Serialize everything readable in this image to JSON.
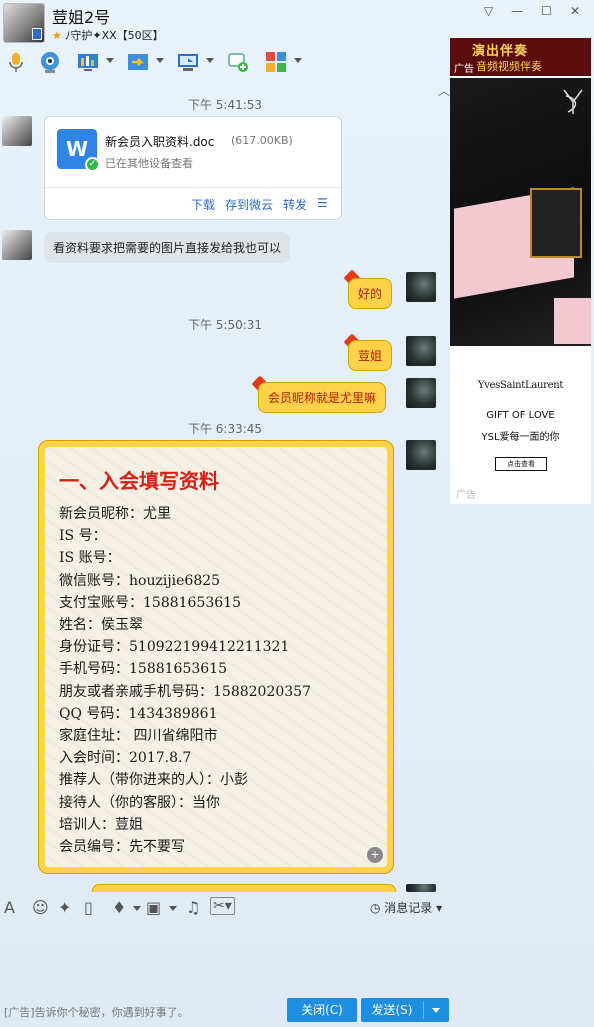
{
  "header": {
    "title": "荳姐2号",
    "status": "ﾉ守护✦XX【50区】",
    "window_controls": {
      "menu": "▽",
      "minimize": "—",
      "maximize": "☐",
      "close": "✕"
    }
  },
  "toolbar": {
    "icons": [
      "microphone-icon",
      "video-call-icon",
      "screen-share-icon",
      "file-transfer-icon",
      "remote-desktop-icon",
      "new-chat-icon",
      "apps-icon"
    ]
  },
  "messages": {
    "time1": "下午 5:41:53",
    "file": {
      "name": "新会员入职资料.doc",
      "size": "(617.00KB)",
      "sub": "已在其他设备查看",
      "download": "下载",
      "save_cloud": "存到微云",
      "forward": "转发",
      "more": "☰"
    },
    "msg_gray": "看资料要求把需要的图片直接发给我也可以",
    "msg_ok": "好的",
    "time2": "下午 5:50:31",
    "msg_sis": "荳姐",
    "msg_nick": "会员昵称就是尤里嘛",
    "time3": "下午 6:33:45"
  },
  "form": {
    "title": "一、入会填写资料",
    "lines": [
      "新会员昵称：尤里",
      "IS 号：",
      "IS 账号：",
      "微信账号：houzijie6825",
      "支付宝账号：15881653615",
      "姓名：侯玉翠",
      "身份证号：510922199412211321",
      "手机号码：15881653615",
      "朋友或者亲戚手机号码：15882020357",
      "QQ 号码：1434389861",
      "家庭住址： 四川省绵阳市",
      "入会时间：2017.8.7",
      "推荐人（带你进来的人）：小彭",
      "接待人（你的客服）：当你",
      "培训人：荳姐",
      "会员编号：先不要写"
    ]
  },
  "ad": {
    "top_line1": "演出伴奏",
    "top_line2": "音频视频伴奏",
    "top_tag": "广告",
    "brand": "YvesSaintLaurent",
    "gift": "GIFT OF LOVE",
    "gift2": "YSL爱每一面的你",
    "button": "点击查看",
    "tag": "广告"
  },
  "input_toolbar": {
    "history": "消息记录"
  },
  "bottom": {
    "ad_text": "[广告]告诉你个秘密，你遇到好事了。",
    "close": "关闭(C)",
    "send": "发送(S)"
  }
}
